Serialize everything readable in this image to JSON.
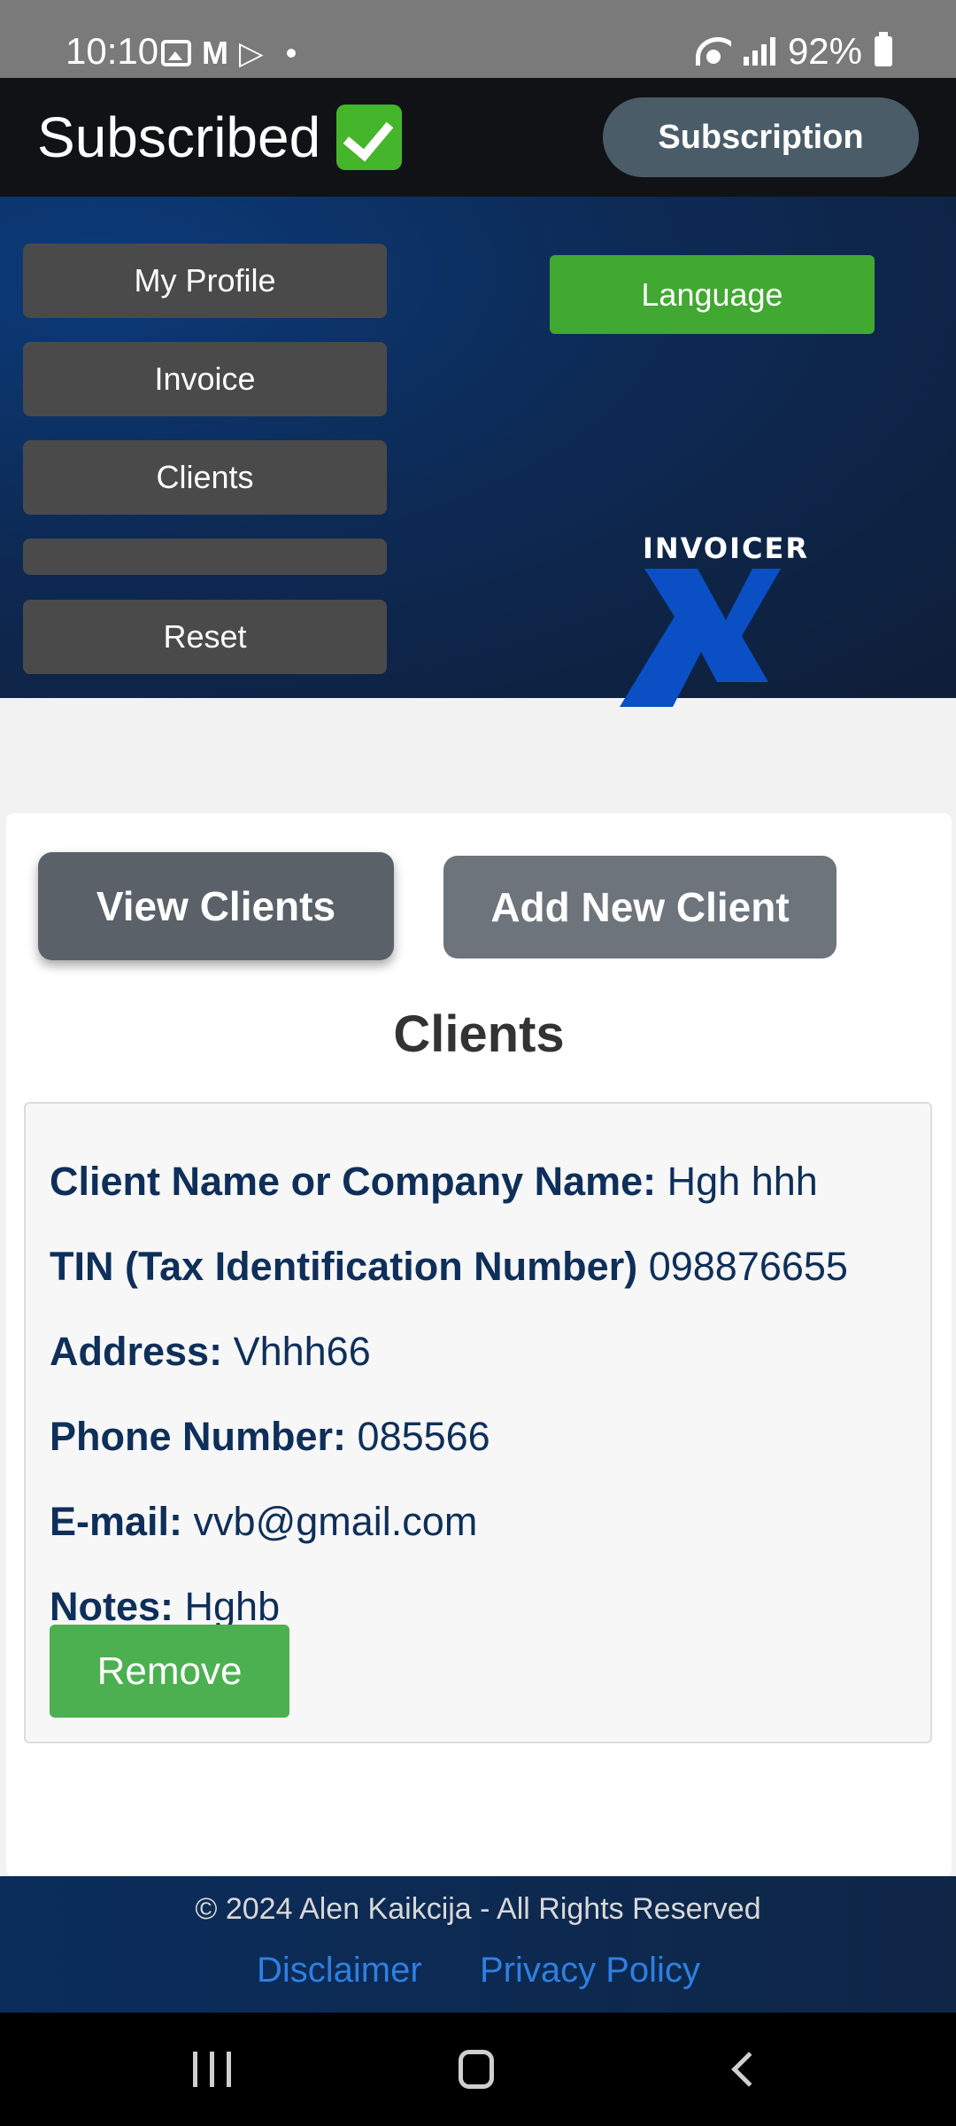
{
  "status_bar": {
    "time": "10:10",
    "battery": "92%",
    "icons": [
      "gallery-icon",
      "gmail-icon",
      "play-store-icon",
      "dot-icon",
      "wifi-icon",
      "signal-icon",
      "battery-icon"
    ]
  },
  "header": {
    "title": "Subscribed",
    "title_icon": "check-mark-icon",
    "subscription_label": "Subscription"
  },
  "menu": {
    "items": [
      {
        "label": "My Profile"
      },
      {
        "label": "Invoice"
      },
      {
        "label": "Clients"
      },
      {
        "label": ""
      },
      {
        "label": "Reset"
      }
    ],
    "language_label": "Language"
  },
  "logo": {
    "text": "INVOICER",
    "letter": "X"
  },
  "tabs": {
    "view_clients": "View Clients",
    "add_new_client": "Add New Client"
  },
  "clients": {
    "heading": "Clients",
    "entries": [
      {
        "name_label": "Client Name or Company Name:",
        "name_value": "Hgh hhh",
        "tin_label": "TIN (Tax Identification Number)",
        "tin_value": "098876655",
        "address_label": "Address:",
        "address_value": "Vhhh66",
        "phone_label": "Phone Number:",
        "phone_value": "085566",
        "email_label": "E-mail:",
        "email_value": "vvb@gmail.com",
        "notes_label": "Notes:",
        "notes_value": "Hghb",
        "remove_label": "Remove"
      }
    ]
  },
  "footer": {
    "copyright": "© 2024 Alen Kaikcija - All Rights Reserved",
    "disclaimer": "Disclaimer",
    "privacy": "Privacy Policy"
  },
  "colors": {
    "accent_green": "#41a832",
    "remove_green": "#4cb050",
    "header_bg": "#111215",
    "hero_blue": "#0d2a55",
    "text_navy": "#0e2f5a",
    "link_blue": "#2f7fe0"
  }
}
